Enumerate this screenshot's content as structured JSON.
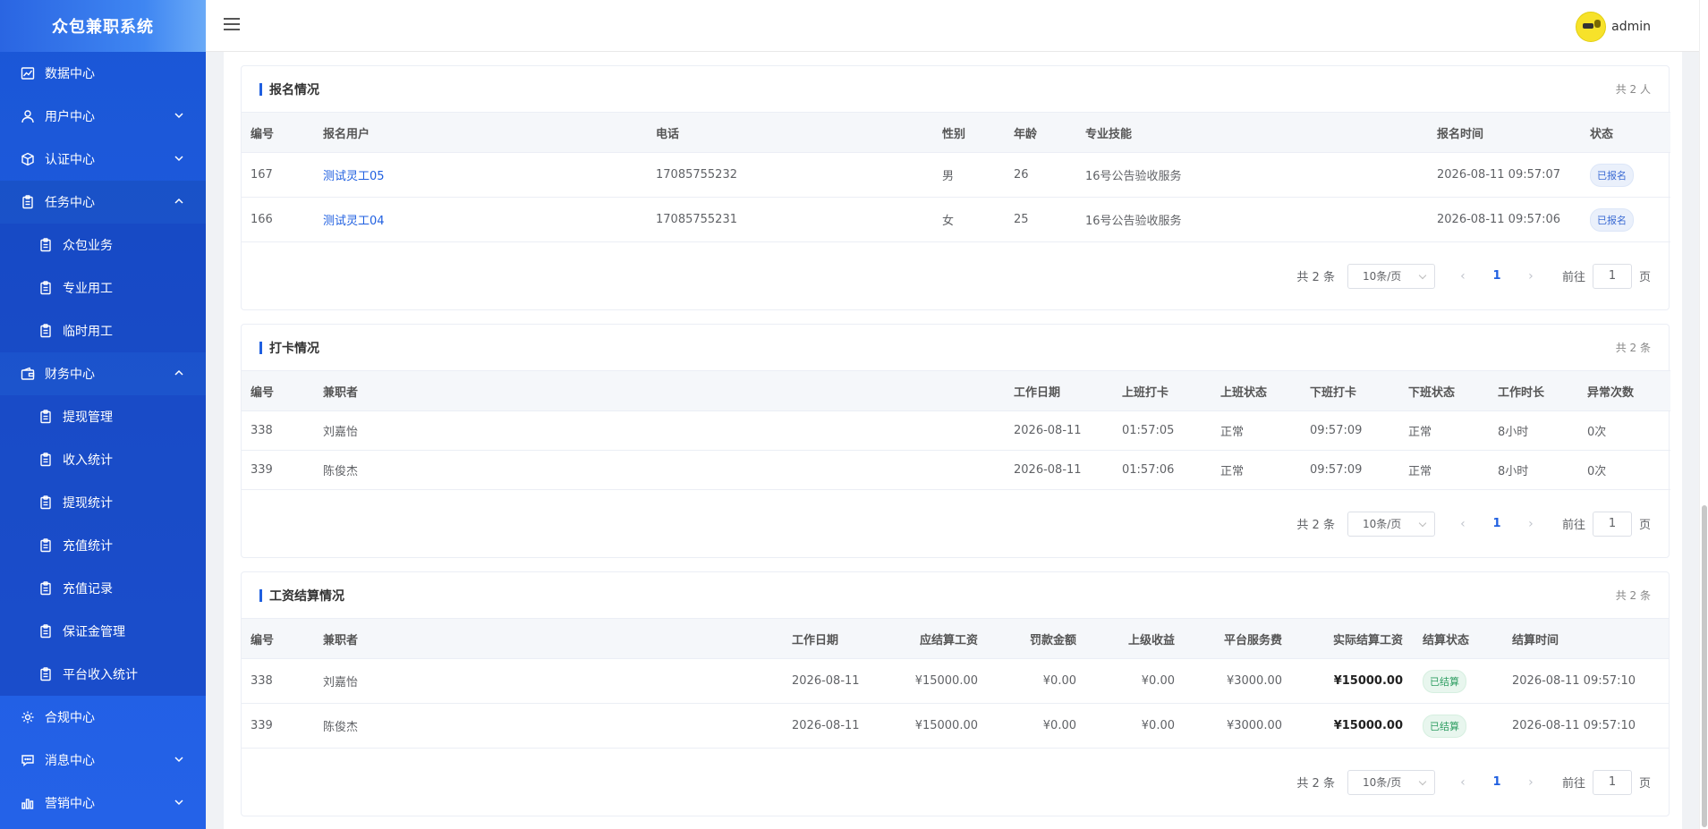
{
  "app": {
    "title": "众包兼职系统"
  },
  "sidebar": {
    "items": [
      {
        "label": "数据中心",
        "icon": "chart-icon"
      },
      {
        "label": "用户中心",
        "icon": "user-icon"
      },
      {
        "label": "认证中心",
        "icon": "cube-icon"
      },
      {
        "label": "任务中心",
        "icon": "clipboard-icon"
      },
      {
        "label": "财务中心",
        "icon": "wallet-icon"
      },
      {
        "label": "合规中心",
        "icon": "gear-icon"
      },
      {
        "label": "消息中心",
        "icon": "message-icon"
      },
      {
        "label": "营销中心",
        "icon": "bar-chart-icon"
      }
    ],
    "task_sub": [
      "众包业务",
      "专业用工",
      "临时用工"
    ],
    "finance_sub": [
      "提现管理",
      "收入统计",
      "提现统计",
      "充值统计",
      "充值记录",
      "保证金管理",
      "平台收入统计"
    ]
  },
  "header": {
    "username": "admin"
  },
  "signup": {
    "title": "报名情况",
    "count": "共 2 人",
    "columns": [
      "编号",
      "报名用户",
      "电话",
      "性别",
      "年龄",
      "专业技能",
      "报名时间",
      "状态"
    ],
    "rows": [
      [
        "167",
        "测试灵工05",
        "17085755232",
        "男",
        "26",
        "16号公告验收服务",
        "2026-08-11 09:57:07",
        "已报名"
      ],
      [
        "166",
        "测试灵工04",
        "17085755231",
        "女",
        "25",
        "16号公告验收服务",
        "2026-08-11 09:57:06",
        "已报名"
      ]
    ]
  },
  "checkin": {
    "title": "打卡情况",
    "count": "共 2 条",
    "columns": [
      "编号",
      "兼职者",
      "工作日期",
      "上班打卡",
      "上班状态",
      "下班打卡",
      "下班状态",
      "工作时长",
      "异常次数"
    ],
    "rows": [
      [
        "338",
        "刘嘉怡",
        "2026-08-11",
        "01:57:05",
        "正常",
        "09:57:09",
        "正常",
        "8小时",
        "0次"
      ],
      [
        "339",
        "陈俊杰",
        "2026-08-11",
        "01:57:06",
        "正常",
        "09:57:09",
        "正常",
        "8小时",
        "0次"
      ]
    ]
  },
  "salary": {
    "title": "工资结算情况",
    "count": "共 2 条",
    "columns": [
      "编号",
      "兼职者",
      "工作日期",
      "应结算工资",
      "罚款金额",
      "上级收益",
      "平台服务费",
      "实际结算工资",
      "结算状态",
      "结算时间"
    ],
    "rows": [
      [
        "338",
        "刘嘉怡",
        "2026-08-11",
        "¥15000.00",
        "¥0.00",
        "¥0.00",
        "¥3000.00",
        "¥15000.00",
        "已结算",
        "2026-08-11 09:57:10"
      ],
      [
        "339",
        "陈俊杰",
        "2026-08-11",
        "¥15000.00",
        "¥0.00",
        "¥0.00",
        "¥3000.00",
        "¥15000.00",
        "已结算",
        "2026-08-11 09:57:10"
      ]
    ]
  },
  "pager": {
    "total": "共 2 条",
    "page_size": "10条/页",
    "current_page": "1",
    "goto_prefix": "前往",
    "goto_value": "1",
    "goto_suffix": "页"
  },
  "colors": {
    "primary": "#1f5fe0",
    "sidebar": "#1a56d6",
    "success": "#2f9e63"
  }
}
